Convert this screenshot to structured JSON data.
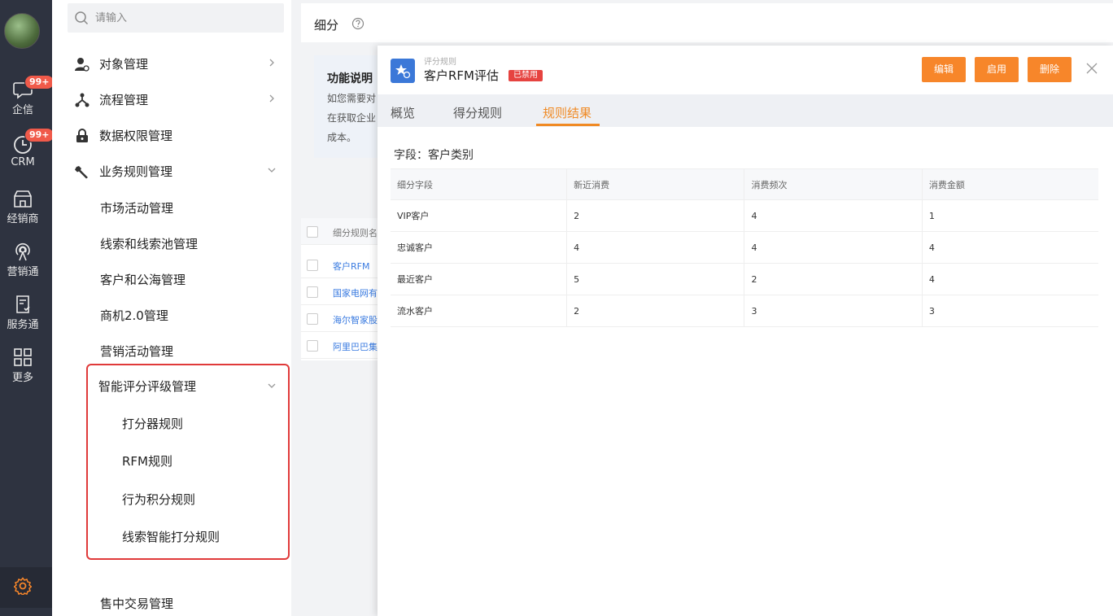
{
  "rail": {
    "items": [
      {
        "label": "企信",
        "badge": "99+"
      },
      {
        "label": "CRM",
        "badge": "99+"
      },
      {
        "label": "经销商"
      },
      {
        "label": "营销通"
      },
      {
        "label": "服务通"
      },
      {
        "label": "更多"
      }
    ]
  },
  "menu": {
    "search_placeholder": "请输入",
    "items": [
      {
        "label": "对象管理"
      },
      {
        "label": "流程管理"
      },
      {
        "label": "数据权限管理"
      },
      {
        "label": "业务规则管理"
      }
    ],
    "subitems": [
      "市场活动管理",
      "线索和线索池管理",
      "客户和公海管理",
      "商机2.0管理",
      "营销活动管理"
    ],
    "scoring": {
      "label": "智能评分评级管理",
      "children": [
        "打分器规则",
        "RFM规则",
        "行为积分规则",
        "线索智能打分规则"
      ]
    },
    "bottom_item": "售中交易管理"
  },
  "main": {
    "title": "细分",
    "info": {
      "title": "功能说明",
      "lines": [
        "如您需要对",
        "在获取企业",
        "成本。"
      ]
    },
    "list": {
      "header": "细分规则名",
      "rows": [
        "客户RFM",
        "国家电网有",
        "海尔智家股",
        "阿里巴巴集"
      ]
    }
  },
  "drawer": {
    "subtitle": "评分规则",
    "title": "客户RFM评估",
    "status_tag": "已禁用",
    "buttons": {
      "edit": "编辑",
      "enable": "启用",
      "delete": "删除"
    },
    "tabs": [
      "概览",
      "得分规则",
      "规则结果"
    ],
    "active_tab": "规则结果",
    "field_label": "字段：客户类别",
    "table": {
      "headers": [
        "细分字段",
        "新近消费",
        "消费频次",
        "消费金额"
      ],
      "rows": [
        [
          "VIP客户",
          "2",
          "4",
          "1"
        ],
        [
          "忠诚客户",
          "4",
          "4",
          "4"
        ],
        [
          "最近客户",
          "5",
          "2",
          "4"
        ],
        [
          "流水客户",
          "2",
          "3",
          "3"
        ]
      ]
    }
  },
  "colors": {
    "rail_bg": "#2e3340",
    "accent_orange": "#f7862a",
    "badge_red": "#f05a4a",
    "tag_red": "#e64340",
    "link_blue": "#3a7be0",
    "highlight_red": "#e03a3a"
  }
}
